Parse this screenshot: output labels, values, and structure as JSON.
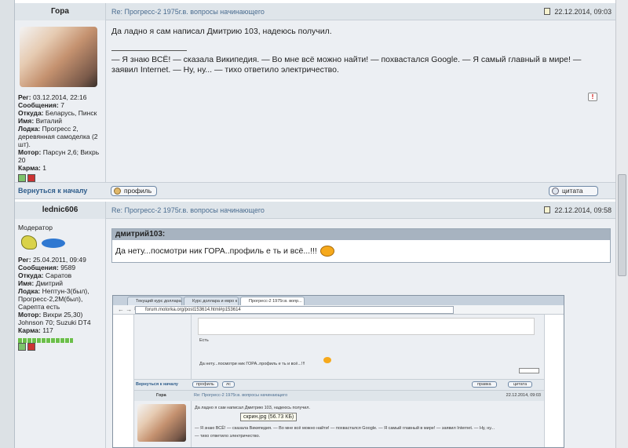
{
  "post1": {
    "author": "Гора",
    "subject": "Re: Прогресс-2 1975г.в. вопросы начинающего",
    "date": "22.12.2014, 09:03",
    "body_line1": "Да ладно я сам написал Дмитрию 103, надеюсь получил.",
    "sig_line1": "— Я знаю ВСЁ! — сказала Википедия. — Во мне всё можно найти! — похвастался Google. — Я самый главный в мире! —",
    "sig_line2": "заявил Internet. — Ну, ну... — тихо ответило электричество.",
    "profile": [
      {
        "k": "Рег:",
        "v": "03.12.2014, 22:16"
      },
      {
        "k": "Сообщения:",
        "v": "7"
      },
      {
        "k": "Откуда:",
        "v": "Беларусь, Пинск"
      },
      {
        "k": "Имя:",
        "v": "Виталий"
      },
      {
        "k": "Лодка:",
        "v": "Прогресс 2, деревянная самоделка (2 шт)."
      },
      {
        "k": "Мотор:",
        "v": "Парсун 2,6; Вихрь 20"
      },
      {
        "k": "Карма:",
        "v": "1"
      }
    ],
    "back_label": "Вернуться к началу",
    "profile_btn": "профиль",
    "quote_btn": "цитата"
  },
  "post2": {
    "author": "lednic606",
    "subject": "Re: Прогресс-2 1975г.в. вопросы начинающего",
    "date": "22.12.2014, 09:58",
    "role": "Модератор",
    "profile": [
      {
        "k": "Рег:",
        "v": "25.04.2011, 09:49"
      },
      {
        "k": "Сообщения:",
        "v": "9589"
      },
      {
        "k": "Откуда:",
        "v": "Саратов"
      },
      {
        "k": "Имя:",
        "v": "Дмитрий"
      },
      {
        "k": "Лодка:",
        "v": "Нептун-3(был), Прогресс-2,2М(был), Сарепта есть"
      },
      {
        "k": "Мотор:",
        "v": "Вихри 25,30) Johnson 70; Suzuki DT4"
      },
      {
        "k": "Карма:",
        "v": "117"
      }
    ],
    "quote_author": "дмитрий103:",
    "quote_text": "Да нету...посмотри ник ГОРА..профиль е ть и всё...!!!"
  },
  "screenshot": {
    "tabs": [
      "Текущий курс доллара к ...",
      "Курс доллара и евро к р...",
      "Прогресс-2 1975г.в. вопр..."
    ],
    "url": "forum.motorka.org/post153614.html#p153614",
    "inner_text1": "Есть",
    "inner_text2": "Да нету...посмотри ник ГОРА..профиль е ть и всё...!!!",
    "back": "Вернуться к началу",
    "btn1": "профиль",
    "btn2": "лс",
    "btn3": "правка",
    "btn4": "цитата",
    "author": "Гора",
    "subject": "Re: Прогресс-2 1975г.в. вопросы начинающего",
    "date": "22.12.2014, 09:03",
    "line1": "Да ладно я сам написал Дмитрию 103, надеюсь получил.",
    "line2": "— Я знаю ВСЁ! — сказала Википедия. — Во мне всё можно найти! — похвастался Google. — Я самый главный в мире! — заявил Internet. — Ну, ну...",
    "line3": "— тихо ответило электричество.",
    "tooltip": "скрин.jpg (56.73 КБ)"
  }
}
